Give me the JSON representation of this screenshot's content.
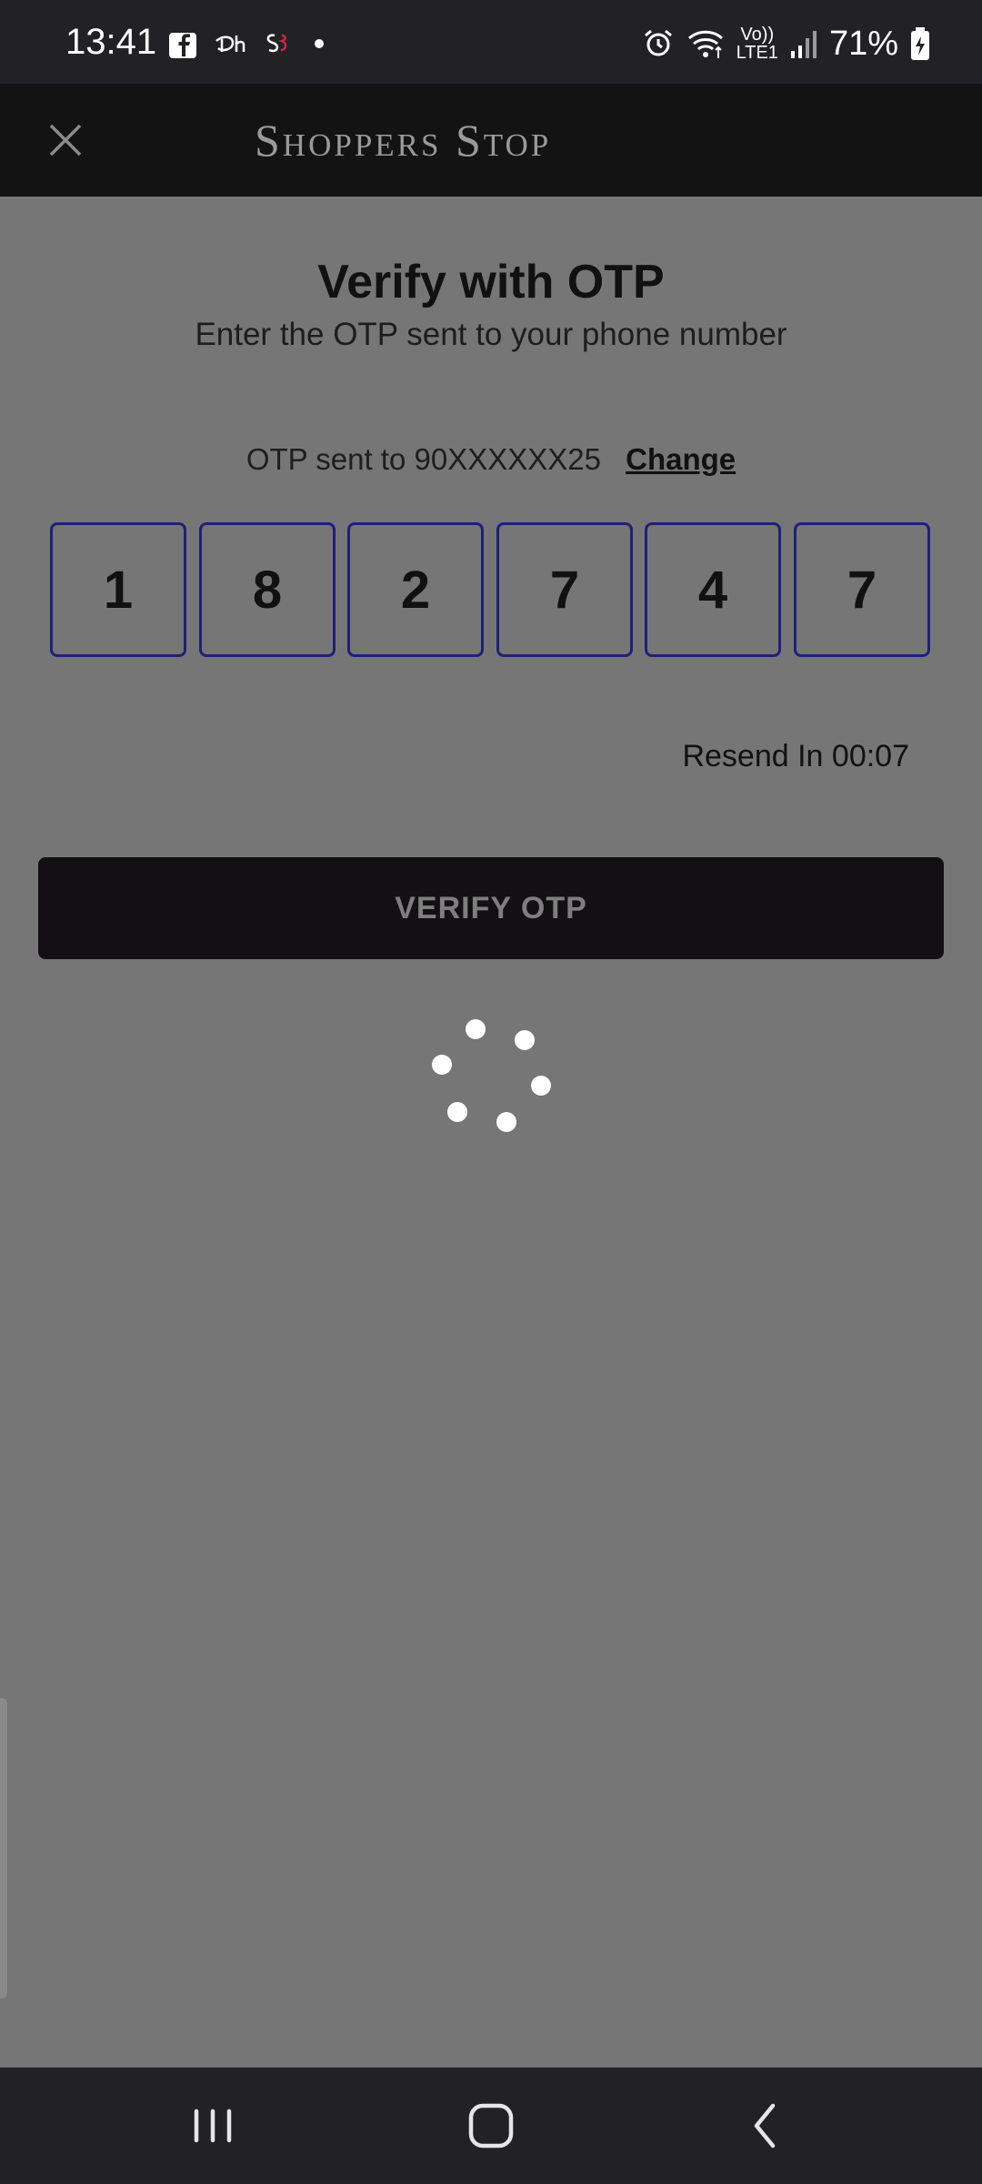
{
  "status_bar": {
    "time": "13:41",
    "battery": "71%",
    "left_icons": [
      "facebook-notification-icon",
      "disney-hotstar-icon",
      "shoppers-stop-icon",
      "more-dot-icon"
    ],
    "right_icons": [
      "alarm-icon",
      "wifi-icon",
      "volte-lte1-icon",
      "signal-icon",
      "battery-charging-icon"
    ],
    "volte_label": "Vo))",
    "lte_label": "LTE1"
  },
  "header": {
    "brand": "Shoppers Stop",
    "close_icon": "close-icon"
  },
  "main": {
    "title": "Verify with OTP",
    "subtitle": "Enter the OTP sent to your phone number",
    "sent_to_text": "OTP sent to 90XXXXXX25",
    "change_label": "Change",
    "otp_digits": [
      "1",
      "8",
      "2",
      "7",
      "4",
      "7"
    ],
    "resend_text": "Resend In 00:07",
    "verify_button": "VERIFY OTP",
    "loading": "loading-spinner-icon"
  },
  "nav_bar": {
    "icons": [
      "recent-apps-icon",
      "home-icon",
      "back-icon"
    ]
  },
  "colors": {
    "overlay_background": "#767676",
    "header_background": "#141314",
    "otp_border": "#202078",
    "verify_button_bg": "#121012",
    "verify_button_text": "#7e7e7e"
  }
}
